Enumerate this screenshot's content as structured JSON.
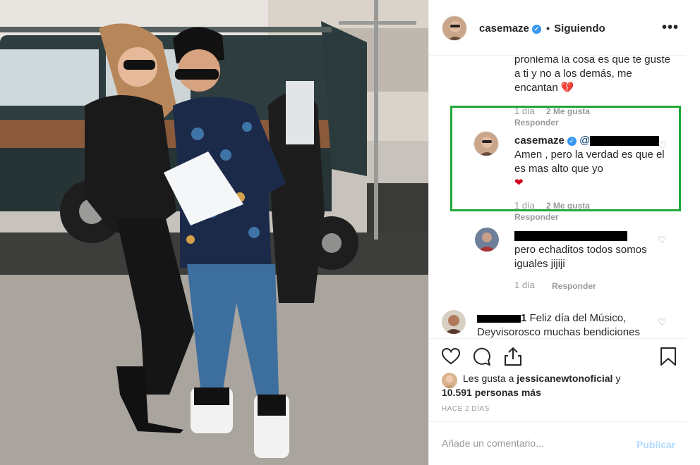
{
  "header": {
    "username": "casemaze",
    "separator": "•",
    "follow_status": "Siguiendo",
    "more_icon": "more-horizontal-icon"
  },
  "comments": {
    "first": {
      "text": "pronlema la cosa es que te guste a ti y no a los demás, me encantan",
      "emoji": "💔",
      "time": "1 día",
      "likes": "2 Me gusta",
      "reply": "Responder"
    },
    "highlighted": {
      "username": "casemaze",
      "mention_visible": "@",
      "text": "Amen , pero la verdad es que el es mas alto que yo",
      "emoji": "❤",
      "time": "1 día",
      "likes": "2 Me gusta",
      "reply": "Responder",
      "highlight_color": "#22a83a"
    },
    "third": {
      "text": "pero echaditos todos somos iguales jijiji",
      "time": "1 día",
      "reply": "Responder"
    },
    "fourth": {
      "user_suffix": "1",
      "text": "Feliz día del Músico, Deyvisorosco muchas bendiciones"
    }
  },
  "likes": {
    "prefix": "Les gusta a",
    "user": "jessicanewtonoficial",
    "conj": "y",
    "count": "10.591 personas más"
  },
  "timestamp": "HACE 2 DÍAS",
  "add_comment": {
    "placeholder": "Añade un comentario...",
    "post_label": "Publicar"
  },
  "colors": {
    "verified": "#3897f0",
    "post_disabled": "#b3dbff",
    "meta_gray": "#999999"
  }
}
